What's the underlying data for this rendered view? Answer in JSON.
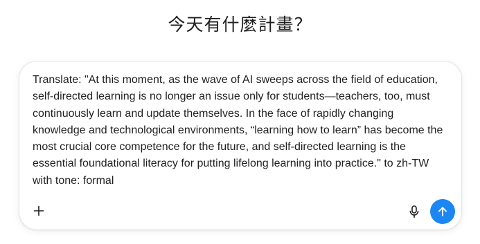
{
  "heading": "今天有什麼計畫？",
  "composer": {
    "prompt_text": "Translate: \"At this moment, as the wave of AI sweeps across the field of education, self-directed learning is no longer an issue only for students—teachers, too, must continuously learn and update themselves. In the face of rapidly changing knowledge and technological environments, “learning how to learn” has become the most crucial core competence for the future, and self-directed learning is the essential foundational literacy for putting lifelong learning into practice.\" to zh-TW with tone: formal",
    "icons": {
      "add": "plus-icon",
      "voice": "microphone-icon",
      "send": "arrow-up-icon"
    },
    "accent_color": "#1c86f2"
  }
}
